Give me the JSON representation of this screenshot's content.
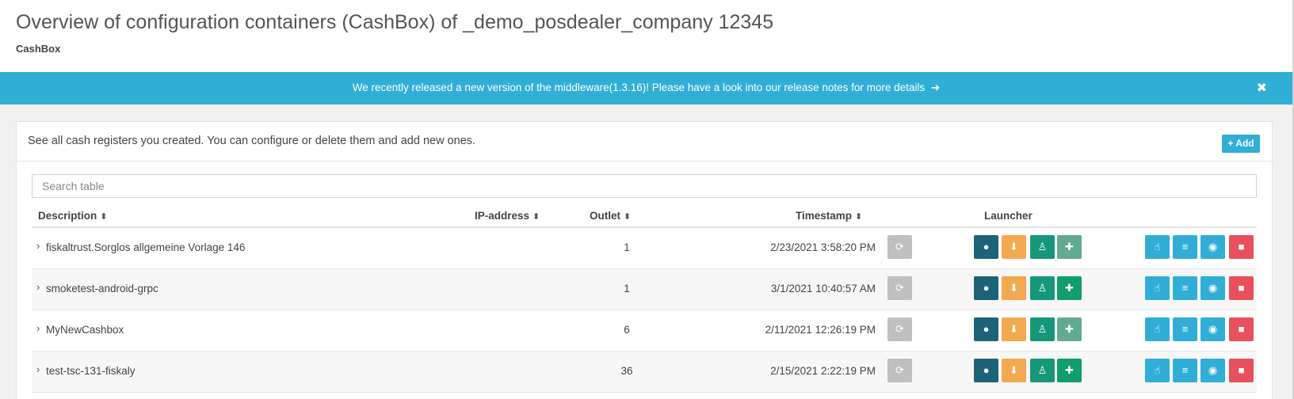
{
  "header": {
    "title": "Overview of configuration containers (CashBox) of _demo_posdealer_company 12345",
    "subtitle": "CashBox"
  },
  "banner": {
    "text": "We recently released a new version of the middleware(1.3.16)! Please have a look into our release notes for more details",
    "arrow_icon": "➔",
    "close_icon": "✖"
  },
  "panel": {
    "description": "See all cash registers you created. You can configure or delete them and add new ones.",
    "add_label": "+ Add"
  },
  "search": {
    "placeholder": "Search table"
  },
  "table": {
    "columns": {
      "description": "Description",
      "ip": "IP-address",
      "outlet": "Outlet",
      "timestamp": "Timestamp",
      "launcher": "Launcher"
    },
    "sort_icon": "⬍",
    "expand_icon": "›",
    "rows": [
      {
        "description": "fiskaltrust.Sorglos allgemeine Vorlage 146",
        "ip": "",
        "outlet": "1",
        "timestamp": "2/23/2021 3:58:20 PM",
        "android_muted": true
      },
      {
        "description": "smoketest-android-grpc",
        "ip": "",
        "outlet": "1",
        "timestamp": "3/1/2021 10:40:57 AM",
        "android_muted": false
      },
      {
        "description": "MyNewCashbox",
        "ip": "",
        "outlet": "6",
        "timestamp": "2/11/2021 12:26:19 PM",
        "android_muted": true
      },
      {
        "description": "test-tsc-131-fiskaly",
        "ip": "",
        "outlet": "36",
        "timestamp": "2/15/2021 2:22:19 PM",
        "android_muted": false
      }
    ]
  },
  "icons": {
    "refresh": "⟳",
    "web": "●",
    "download": "⬇",
    "linux": "♙",
    "android": "✚",
    "touch": "☝",
    "list": "≡",
    "view": "◉",
    "delete": "■"
  },
  "colors": {
    "accent": "#30aed6",
    "danger": "#e8505d",
    "warning": "#f3a94f",
    "success": "#16977a",
    "dark": "#1d6377"
  }
}
